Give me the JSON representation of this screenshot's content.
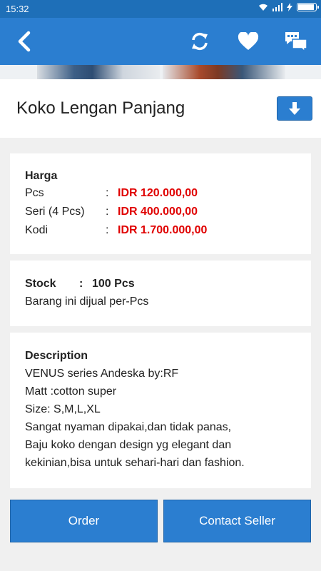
{
  "status_bar": {
    "time": "15:32",
    "battery_level": 0.85
  },
  "app_bar": {
    "icons": [
      "back-arrow-icon",
      "refresh-icon",
      "heart-icon",
      "chat-icon"
    ]
  },
  "product": {
    "title": "Koko Lengan Panjang"
  },
  "price": {
    "heading": "Harga",
    "rows": [
      {
        "label": "Pcs",
        "sep": ":",
        "value": "IDR 120.000,00"
      },
      {
        "label": "Seri (4 Pcs)",
        "sep": ":",
        "value": "IDR 400.000,00"
      },
      {
        "label": "Kodi",
        "sep": ":",
        "value": "IDR 1.700.000,00"
      }
    ]
  },
  "stock": {
    "label": "Stock",
    "sep": ":",
    "value": "100 Pcs",
    "note": "Barang ini dijual per-Pcs"
  },
  "description": {
    "heading": "Description",
    "lines": [
      "VENUS series Andeska by:RF",
      "Matt :cotton super",
      "Size: S,M,L,XL",
      "Sangat nyaman dipakai,dan tidak panas,",
      "Baju koko dengan design yg elegant dan",
      "kekinian,bisa untuk sehari-hari dan fashion."
    ]
  },
  "actions": {
    "order_label": "Order",
    "contact_label": "Contact Seller"
  },
  "colors": {
    "primary": "#2b7ed0",
    "status_bar": "#1e6fb8",
    "price_red": "#e00000"
  }
}
